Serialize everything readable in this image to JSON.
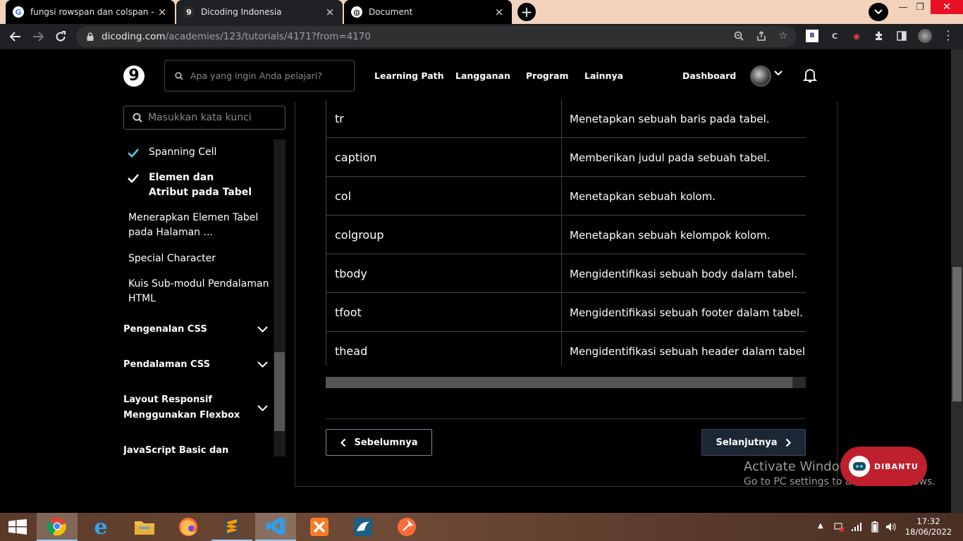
{
  "browser": {
    "tabs": [
      {
        "title": "fungsi rowspan dan colspan - Pe",
        "favicon": "google-icon"
      },
      {
        "title": "Dicoding Indonesia",
        "favicon": "dicoding-icon"
      },
      {
        "title": "Document",
        "favicon": "globe-icon"
      }
    ],
    "url_domain": "dicoding.com",
    "url_path": "/academies/123/tutorials/4171?from=4170"
  },
  "header": {
    "search_placeholder": "Apa yang ingin Anda pelajari?",
    "nav": [
      "Learning Path",
      "Langganan",
      "Program",
      "Lainnya"
    ],
    "dashboard": "Dashboard"
  },
  "sidebar": {
    "search_placeholder": "Masukkan kata kunci",
    "items": [
      {
        "label": "Spanning Cell",
        "state": "done"
      },
      {
        "label": "Elemen dan Atribut pada Tabel",
        "state": "current"
      },
      {
        "label": "Menerapkan Elemen Tabel pada Halaman ...",
        "state": "todo"
      },
      {
        "label": "Special Character",
        "state": "todo"
      },
      {
        "label": "Kuis Sub-modul Pendalaman HTML",
        "state": "todo"
      }
    ],
    "sections": [
      "Pengenalan CSS",
      "Pendalaman CSS",
      "Layout Responsif Menggunakan Flexbox",
      "JavaScript Basic dan"
    ]
  },
  "table": {
    "rows": [
      {
        "tag": "tr",
        "desc": "Menetapkan sebuah baris pada tabel."
      },
      {
        "tag": "caption",
        "desc": "Memberikan judul pada sebuah tabel."
      },
      {
        "tag": "col",
        "desc": "Menetapkan sebuah kolom."
      },
      {
        "tag": "colgroup",
        "desc": "Menetapkan sebuah kelompok kolom."
      },
      {
        "tag": "tbody",
        "desc": "Mengidentifikasi sebuah body dalam tabel."
      },
      {
        "tag": "tfoot",
        "desc": "Mengidentifikasi sebuah footer dalam tabel."
      },
      {
        "tag": "thead",
        "desc": "Mengidentifikasi sebuah header dalam tabel"
      }
    ]
  },
  "pagination": {
    "prev": "Sebelumnya",
    "next": "Selanjutnya"
  },
  "watermark": {
    "line1": "Activate Windows",
    "line2": "Go to PC settings to activate Windows."
  },
  "help_widget": {
    "label": "DIBANTU"
  },
  "taskbar": {
    "time": "17:32",
    "date": "18/06/2022"
  },
  "colors": {
    "accent_check": "#4fd1e8",
    "next_button_bg": "#1b2734",
    "help_widget": "#c0202e"
  }
}
